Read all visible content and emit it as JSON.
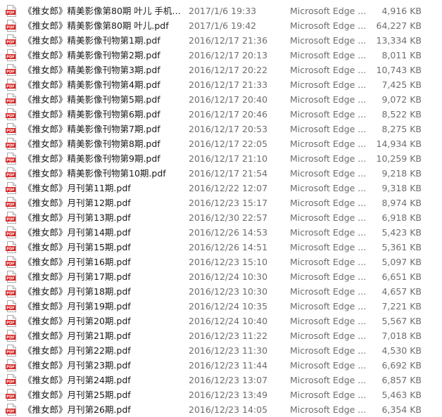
{
  "files": [
    {
      "name": "《推女郎》精美影像第80期 叶儿 手机阅...",
      "date": "2017/1/6 19:33",
      "type": "Microsoft Edge ...",
      "size": "4,916 KB",
      "icon": "pdf-icon"
    },
    {
      "name": "《推女郎》精美影像第80期 叶儿.pdf",
      "date": "2017/1/6 19:42",
      "type": "Microsoft Edge ...",
      "size": "64,227 KB",
      "icon": "pdf-icon"
    },
    {
      "name": "《推女郎》精美影像刊物第1期.pdf",
      "date": "2016/12/17 21:36",
      "type": "Microsoft Edge ...",
      "size": "13,334 KB",
      "icon": "pdf-icon"
    },
    {
      "name": "《推女郎》精美影像刊物第2期.pdf",
      "date": "2016/12/17 20:13",
      "type": "Microsoft Edge ...",
      "size": "8,011 KB",
      "icon": "pdf-icon"
    },
    {
      "name": "《推女郎》精美影像刊物第3期.pdf",
      "date": "2016/12/17 20:22",
      "type": "Microsoft Edge ...",
      "size": "10,743 KB",
      "icon": "pdf-icon"
    },
    {
      "name": "《推女郎》精美影像刊物第4期.pdf",
      "date": "2016/12/17 21:33",
      "type": "Microsoft Edge ...",
      "size": "7,425 KB",
      "icon": "pdf-icon"
    },
    {
      "name": "《推女郎》精美影像刊物第5期.pdf",
      "date": "2016/12/17 20:40",
      "type": "Microsoft Edge ...",
      "size": "9,072 KB",
      "icon": "pdf-icon"
    },
    {
      "name": "《推女郎》精美影像刊物第6期.pdf",
      "date": "2016/12/17 20:46",
      "type": "Microsoft Edge ...",
      "size": "8,522 KB",
      "icon": "pdf-icon"
    },
    {
      "name": "《推女郎》精美影像刊物第7期.pdf",
      "date": "2016/12/17 20:53",
      "type": "Microsoft Edge ...",
      "size": "8,275 KB",
      "icon": "pdf-icon"
    },
    {
      "name": "《推女郎》精美影像刊物第8期.pdf",
      "date": "2016/12/17 22:05",
      "type": "Microsoft Edge ...",
      "size": "14,934 KB",
      "icon": "pdf-icon"
    },
    {
      "name": "《推女郎》精美影像刊物第9期.pdf",
      "date": "2016/12/17 21:10",
      "type": "Microsoft Edge ...",
      "size": "10,259 KB",
      "icon": "pdf-icon"
    },
    {
      "name": "《推女郎》精美影像刊物第10期.pdf",
      "date": "2016/12/17 21:54",
      "type": "Microsoft Edge ...",
      "size": "9,218 KB",
      "icon": "pdf-icon"
    },
    {
      "name": "《推女郎》月刊第11期.pdf",
      "date": "2016/12/22 12:07",
      "type": "Microsoft Edge ...",
      "size": "9,318 KB",
      "icon": "pdf-icon"
    },
    {
      "name": "《推女郎》月刊第12期.pdf",
      "date": "2016/12/23 15:17",
      "type": "Microsoft Edge ...",
      "size": "8,974 KB",
      "icon": "pdf-icon"
    },
    {
      "name": "《推女郎》月刊第13期.pdf",
      "date": "2016/12/30 22:57",
      "type": "Microsoft Edge ...",
      "size": "6,918 KB",
      "icon": "pdf-icon"
    },
    {
      "name": "《推女郎》月刊第14期.pdf",
      "date": "2016/12/26 14:53",
      "type": "Microsoft Edge ...",
      "size": "5,423 KB",
      "icon": "pdf-icon"
    },
    {
      "name": "《推女郎》月刊第15期.pdf",
      "date": "2016/12/26 14:51",
      "type": "Microsoft Edge ...",
      "size": "5,361 KB",
      "icon": "pdf-icon"
    },
    {
      "name": "《推女郎》月刊第16期.pdf",
      "date": "2016/12/23 15:10",
      "type": "Microsoft Edge ...",
      "size": "5,097 KB",
      "icon": "pdf-icon"
    },
    {
      "name": "《推女郎》月刊第17期.pdf",
      "date": "2016/12/24 10:30",
      "type": "Microsoft Edge ...",
      "size": "6,651 KB",
      "icon": "pdf-icon"
    },
    {
      "name": "《推女郎》月刊第18期.pdf",
      "date": "2016/12/23 10:30",
      "type": "Microsoft Edge ...",
      "size": "4,657 KB",
      "icon": "pdf-icon"
    },
    {
      "name": "《推女郎》月刊第19期.pdf",
      "date": "2016/12/24 10:35",
      "type": "Microsoft Edge ...",
      "size": "7,221 KB",
      "icon": "pdf-icon"
    },
    {
      "name": "《推女郎》月刊第20期.pdf",
      "date": "2016/12/24 10:40",
      "type": "Microsoft Edge ...",
      "size": "5,567 KB",
      "icon": "pdf-icon"
    },
    {
      "name": "《推女郎》月刊第21期.pdf",
      "date": "2016/12/23 11:22",
      "type": "Microsoft Edge ...",
      "size": "7,018 KB",
      "icon": "pdf-icon"
    },
    {
      "name": "《推女郎》月刊第22期.pdf",
      "date": "2016/12/23 11:30",
      "type": "Microsoft Edge ...",
      "size": "4,530 KB",
      "icon": "pdf-icon"
    },
    {
      "name": "《推女郎》月刊第23期.pdf",
      "date": "2016/12/23 11:44",
      "type": "Microsoft Edge ...",
      "size": "6,692 KB",
      "icon": "pdf-icon"
    },
    {
      "name": "《推女郎》月刊第24期.pdf",
      "date": "2016/12/23 13:07",
      "type": "Microsoft Edge ...",
      "size": "6,857 KB",
      "icon": "pdf-icon"
    },
    {
      "name": "《推女郎》月刊第25期.pdf",
      "date": "2016/12/23 13:49",
      "type": "Microsoft Edge ...",
      "size": "5,463 KB",
      "icon": "pdf-icon"
    },
    {
      "name": "《推女郎》月刊第26期.pdf",
      "date": "2016/12/23 14:05",
      "type": "Microsoft Edge ...",
      "size": "6,354 KB",
      "icon": "pdf-icon"
    }
  ],
  "colors": {
    "pdf_icon_red": "#d81e1e",
    "meta_text": "#6d6d6d",
    "name_text": "#1a1a1a"
  }
}
